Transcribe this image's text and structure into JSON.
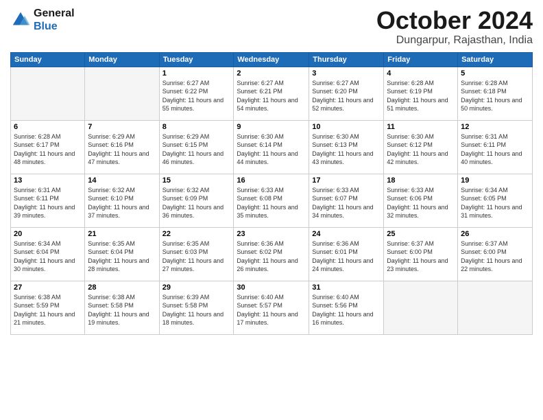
{
  "header": {
    "logo_line1": "General",
    "logo_line2": "Blue",
    "month": "October 2024",
    "location": "Dungarpur, Rajasthan, India"
  },
  "days_of_week": [
    "Sunday",
    "Monday",
    "Tuesday",
    "Wednesday",
    "Thursday",
    "Friday",
    "Saturday"
  ],
  "weeks": [
    [
      {
        "day": "",
        "empty": true
      },
      {
        "day": "",
        "empty": true
      },
      {
        "day": "1",
        "sunrise": "6:27 AM",
        "sunset": "6:22 PM",
        "daylight": "11 hours and 55 minutes."
      },
      {
        "day": "2",
        "sunrise": "6:27 AM",
        "sunset": "6:21 PM",
        "daylight": "11 hours and 54 minutes."
      },
      {
        "day": "3",
        "sunrise": "6:27 AM",
        "sunset": "6:20 PM",
        "daylight": "11 hours and 52 minutes."
      },
      {
        "day": "4",
        "sunrise": "6:28 AM",
        "sunset": "6:19 PM",
        "daylight": "11 hours and 51 minutes."
      },
      {
        "day": "5",
        "sunrise": "6:28 AM",
        "sunset": "6:18 PM",
        "daylight": "11 hours and 50 minutes."
      }
    ],
    [
      {
        "day": "6",
        "sunrise": "6:28 AM",
        "sunset": "6:17 PM",
        "daylight": "11 hours and 48 minutes."
      },
      {
        "day": "7",
        "sunrise": "6:29 AM",
        "sunset": "6:16 PM",
        "daylight": "11 hours and 47 minutes."
      },
      {
        "day": "8",
        "sunrise": "6:29 AM",
        "sunset": "6:15 PM",
        "daylight": "11 hours and 46 minutes."
      },
      {
        "day": "9",
        "sunrise": "6:30 AM",
        "sunset": "6:14 PM",
        "daylight": "11 hours and 44 minutes."
      },
      {
        "day": "10",
        "sunrise": "6:30 AM",
        "sunset": "6:13 PM",
        "daylight": "11 hours and 43 minutes."
      },
      {
        "day": "11",
        "sunrise": "6:30 AM",
        "sunset": "6:12 PM",
        "daylight": "11 hours and 42 minutes."
      },
      {
        "day": "12",
        "sunrise": "6:31 AM",
        "sunset": "6:11 PM",
        "daylight": "11 hours and 40 minutes."
      }
    ],
    [
      {
        "day": "13",
        "sunrise": "6:31 AM",
        "sunset": "6:11 PM",
        "daylight": "11 hours and 39 minutes."
      },
      {
        "day": "14",
        "sunrise": "6:32 AM",
        "sunset": "6:10 PM",
        "daylight": "11 hours and 37 minutes."
      },
      {
        "day": "15",
        "sunrise": "6:32 AM",
        "sunset": "6:09 PM",
        "daylight": "11 hours and 36 minutes."
      },
      {
        "day": "16",
        "sunrise": "6:33 AM",
        "sunset": "6:08 PM",
        "daylight": "11 hours and 35 minutes."
      },
      {
        "day": "17",
        "sunrise": "6:33 AM",
        "sunset": "6:07 PM",
        "daylight": "11 hours and 34 minutes."
      },
      {
        "day": "18",
        "sunrise": "6:33 AM",
        "sunset": "6:06 PM",
        "daylight": "11 hours and 32 minutes."
      },
      {
        "day": "19",
        "sunrise": "6:34 AM",
        "sunset": "6:05 PM",
        "daylight": "11 hours and 31 minutes."
      }
    ],
    [
      {
        "day": "20",
        "sunrise": "6:34 AM",
        "sunset": "6:04 PM",
        "daylight": "11 hours and 30 minutes."
      },
      {
        "day": "21",
        "sunrise": "6:35 AM",
        "sunset": "6:04 PM",
        "daylight": "11 hours and 28 minutes."
      },
      {
        "day": "22",
        "sunrise": "6:35 AM",
        "sunset": "6:03 PM",
        "daylight": "11 hours and 27 minutes."
      },
      {
        "day": "23",
        "sunrise": "6:36 AM",
        "sunset": "6:02 PM",
        "daylight": "11 hours and 26 minutes."
      },
      {
        "day": "24",
        "sunrise": "6:36 AM",
        "sunset": "6:01 PM",
        "daylight": "11 hours and 24 minutes."
      },
      {
        "day": "25",
        "sunrise": "6:37 AM",
        "sunset": "6:00 PM",
        "daylight": "11 hours and 23 minutes."
      },
      {
        "day": "26",
        "sunrise": "6:37 AM",
        "sunset": "6:00 PM",
        "daylight": "11 hours and 22 minutes."
      }
    ],
    [
      {
        "day": "27",
        "sunrise": "6:38 AM",
        "sunset": "5:59 PM",
        "daylight": "11 hours and 21 minutes."
      },
      {
        "day": "28",
        "sunrise": "6:38 AM",
        "sunset": "5:58 PM",
        "daylight": "11 hours and 19 minutes."
      },
      {
        "day": "29",
        "sunrise": "6:39 AM",
        "sunset": "5:58 PM",
        "daylight": "11 hours and 18 minutes."
      },
      {
        "day": "30",
        "sunrise": "6:40 AM",
        "sunset": "5:57 PM",
        "daylight": "11 hours and 17 minutes."
      },
      {
        "day": "31",
        "sunrise": "6:40 AM",
        "sunset": "5:56 PM",
        "daylight": "11 hours and 16 minutes."
      },
      {
        "day": "",
        "empty": true
      },
      {
        "day": "",
        "empty": true
      }
    ]
  ]
}
